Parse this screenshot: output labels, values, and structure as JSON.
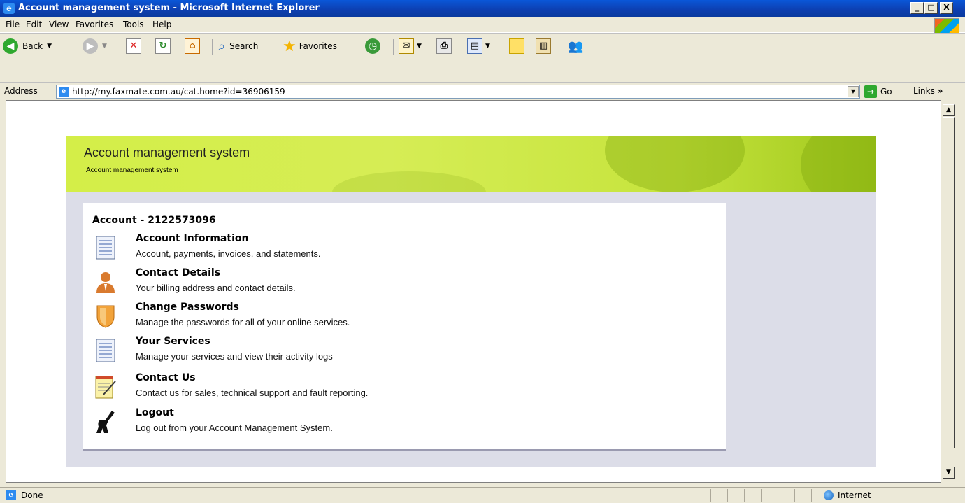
{
  "window": {
    "title": "Account management system - Microsoft Internet Explorer",
    "min": "_",
    "max": "□",
    "close": "X"
  },
  "menu": [
    "File",
    "Edit",
    "View",
    "Favorites",
    "Tools",
    "Help"
  ],
  "toolbar": {
    "back": "Back",
    "search": "Search",
    "favorites": "Favorites"
  },
  "address": {
    "label": "Address",
    "url": "http://my.faxmate.com.au/cat.home?id=36906159",
    "go": "Go",
    "links": "Links"
  },
  "page": {
    "header_title": "Account management system",
    "breadcrumb": "Account management system",
    "account_heading": "Account - 2122573096",
    "items": [
      {
        "title": "Account Information",
        "desc": "Account, payments, invoices, and statements.",
        "icon": "list-icon"
      },
      {
        "title": "Contact Details",
        "desc": "Your billing address and contact details.",
        "icon": "person-icon"
      },
      {
        "title": "Change Passwords",
        "desc": "Manage the passwords for all of your online services.",
        "icon": "shield-icon"
      },
      {
        "title": "Your Services",
        "desc": "Manage your services and view their activity logs",
        "icon": "list-icon"
      },
      {
        "title": "Contact Us",
        "desc": "Contact us for sales, technical support and fault reporting.",
        "icon": "notepad-icon"
      },
      {
        "title": "Logout",
        "desc": "Log out from your Account Management System.",
        "icon": "logout-figure-icon"
      }
    ]
  },
  "status": {
    "text": "Done",
    "zone": "Internet"
  }
}
